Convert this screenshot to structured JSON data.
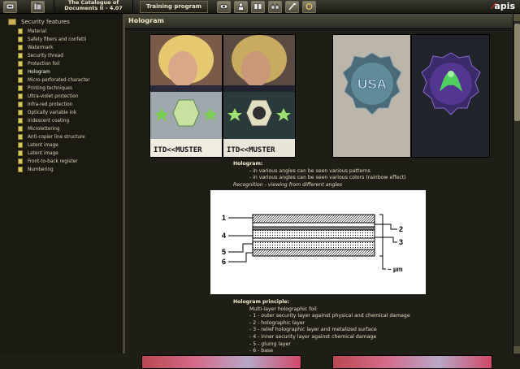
{
  "app": {
    "title_line1": "The Catalogue of",
    "title_line2": "Documents II - 4.07",
    "training_label": "Training program",
    "logo": "apis"
  },
  "toolbar": {
    "left_icons": [
      "catalogue-icon",
      "documents-icon"
    ],
    "right_icons": [
      "eye-icon",
      "person-icon",
      "book-icon",
      "binoculars-icon",
      "tools-icon",
      "ring-icon"
    ]
  },
  "sidebar": {
    "root_label": "Security features",
    "items": [
      {
        "label": "Material"
      },
      {
        "label": "Safety fibers and confetti"
      },
      {
        "label": "Watermark"
      },
      {
        "label": "Security thread"
      },
      {
        "label": "Protection foil"
      },
      {
        "label": "Hologram",
        "selected": true
      },
      {
        "label": "Micro-perforated character"
      },
      {
        "label": "Printing techniques"
      },
      {
        "label": "Ultra-violet protection"
      },
      {
        "label": "Infra-red protection"
      },
      {
        "label": "Optically variable ink"
      },
      {
        "label": "Iridescent coating"
      },
      {
        "label": "Microlettering"
      },
      {
        "label": "Anti-copier line structure"
      },
      {
        "label": "Latent image"
      },
      {
        "label": "Latent image"
      },
      {
        "label": "Front-to-back register"
      },
      {
        "label": "Numbering"
      }
    ]
  },
  "main": {
    "title": "Hologram",
    "photos": {
      "mrz_1": "ITD<<MUSTER",
      "mrz_2": "ITD<<MUSTER",
      "holo_text": "USA"
    },
    "description": {
      "heading": "Hologram:",
      "lines": [
        "- in various angles can be seen various patterns",
        "- in various angles can be seen various colors (rainbow effect)"
      ],
      "recognition": "Recognition - viewing from different angles"
    },
    "diagram": {
      "labels": [
        "1",
        "2",
        "3",
        "4",
        "5",
        "6"
      ],
      "unit": "~ µm"
    },
    "principle": {
      "heading": "Hologram principle:",
      "intro": "Multi-layer holographic foil",
      "lines": [
        "- 1 - outer security layer against physical and chemical damage",
        "- 2 - holographic layer",
        "- 3 - relief holographic layer and metalized surface",
        "- 4 - inner security layer against chemical damage",
        "- 5 - gluing layer",
        "- 6 - base"
      ]
    }
  },
  "colors": {
    "background": "#1e1e16",
    "sidebar": "#1a1a12",
    "text": "#d8d2b8",
    "accent_red": "#e03020",
    "bullet": "#d6c860"
  }
}
